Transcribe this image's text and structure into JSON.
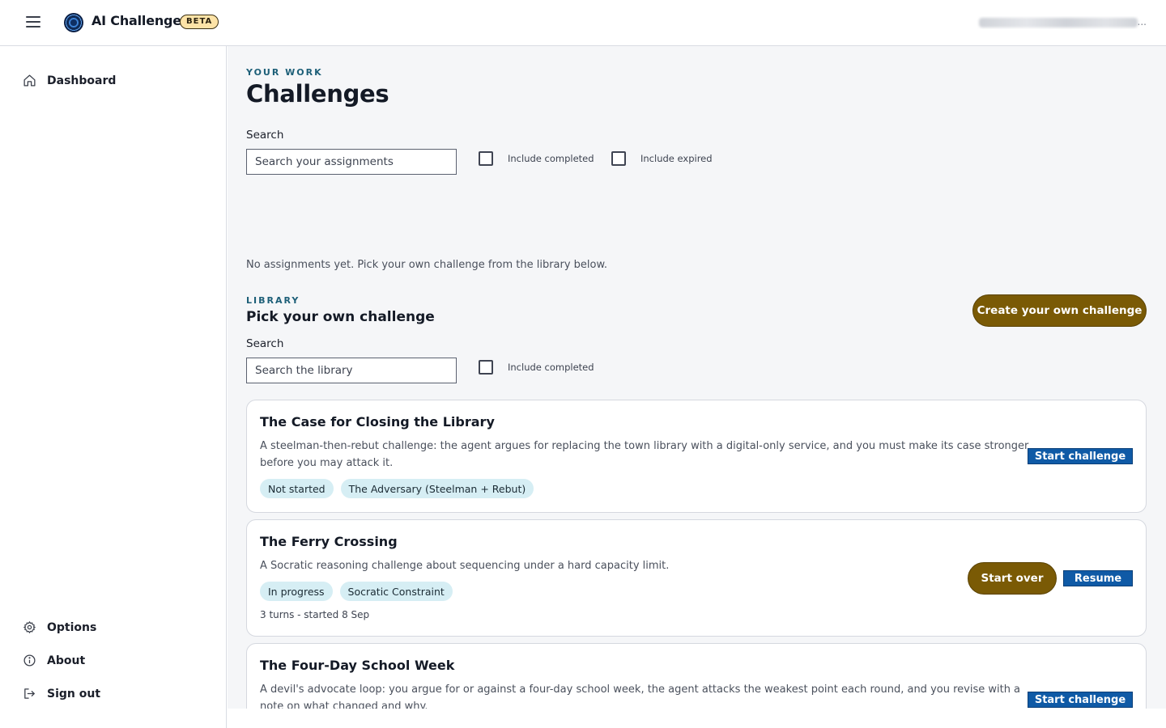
{
  "header": {
    "app_name": "AI Challenge",
    "badge": "BETA",
    "user_ellipsis": "..."
  },
  "sidebar": {
    "top_items": [
      {
        "label": "Dashboard",
        "icon": "home-icon"
      }
    ],
    "bottom_items": [
      {
        "label": "Options",
        "icon": "gear-icon"
      },
      {
        "label": "About",
        "icon": "info-icon"
      },
      {
        "label": "Sign out",
        "icon": "sign-out-icon"
      }
    ]
  },
  "work": {
    "eyebrow": "YOUR WORK",
    "title": "Challenges",
    "search_label": "Search",
    "search_placeholder": "Search your assignments",
    "include_completed": "Include completed",
    "include_expired": "Include expired",
    "empty_message": "No assignments yet. Pick your own challenge from the library below."
  },
  "library": {
    "eyebrow": "LIBRARY",
    "title": "Pick your own challenge",
    "create_button": "Create your own challenge",
    "search_label": "Search",
    "search_placeholder": "Search the library",
    "include_completed": "Include completed",
    "cards": [
      {
        "title": "The Case for Closing the Library",
        "description": "A steelman-then-rebut challenge: the agent argues for replacing the town library with a digital-only service, and you must make its case stronger before you may attack it.",
        "tags": [
          "Not started",
          "The Adversary (Steelman + Rebut)"
        ],
        "primary_button": "Start challenge"
      },
      {
        "title": "The Ferry Crossing",
        "description": "A Socratic reasoning challenge about sequencing under a hard capacity limit.",
        "tags": [
          "In progress",
          "Socratic Constraint"
        ],
        "meta": "3 turns - started 8 Sep",
        "secondary_button": "Start over",
        "primary_button": "Resume"
      },
      {
        "title": "The Four-Day School Week",
        "description": "A devil's advocate loop: you argue for or against a four-day school week, the agent attacks the weakest point each round, and you revise with a note on what changed and why.",
        "primary_button": "Start challenge"
      }
    ]
  },
  "colors": {
    "accent_blue": "#0f5aa6",
    "accent_brown": "#7a5a05",
    "eyebrow_teal": "#1d5f78",
    "tag_bg": "#d6eef4",
    "beta_bg": "#fde3a7"
  }
}
